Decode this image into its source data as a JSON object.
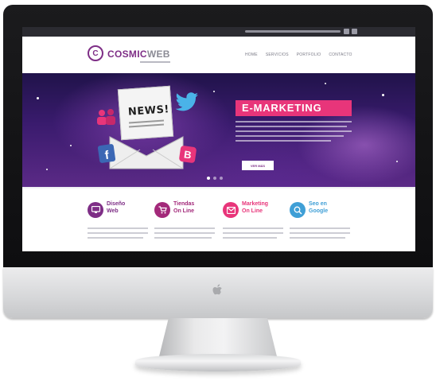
{
  "brand": {
    "name_primary": "COSMIC",
    "name_secondary": "WEB",
    "logo_letter": "C",
    "color_primary": "#7e2e86",
    "color_secondary": "#8b8b95"
  },
  "topbar": {
    "social": [
      "twitter-icon",
      "facebook-icon"
    ]
  },
  "nav": {
    "items": [
      "HOME",
      "SERVICIOS",
      "PORTFOLIO",
      "CONTACTO"
    ]
  },
  "hero": {
    "title": "E-MARKETING",
    "button_label": "VER MÁS",
    "news_label": "NEWS!",
    "accent": "#e8357a",
    "slider_dots": 3,
    "active_dot": 0
  },
  "services": [
    {
      "title_line1": "Diseño",
      "title_line2": "Web",
      "icon": "monitor-icon",
      "color": "#7e2e86"
    },
    {
      "title_line1": "Tiendas",
      "title_line2": "On Line",
      "icon": "cart-icon",
      "color": "#a3297a"
    },
    {
      "title_line1": "Marketing",
      "title_line2": "On Line",
      "icon": "mail-icon",
      "color": "#e8357a"
    },
    {
      "title_line1": "Seo en",
      "title_line2": "Google",
      "icon": "search-icon",
      "color": "#3f9fd6"
    }
  ]
}
